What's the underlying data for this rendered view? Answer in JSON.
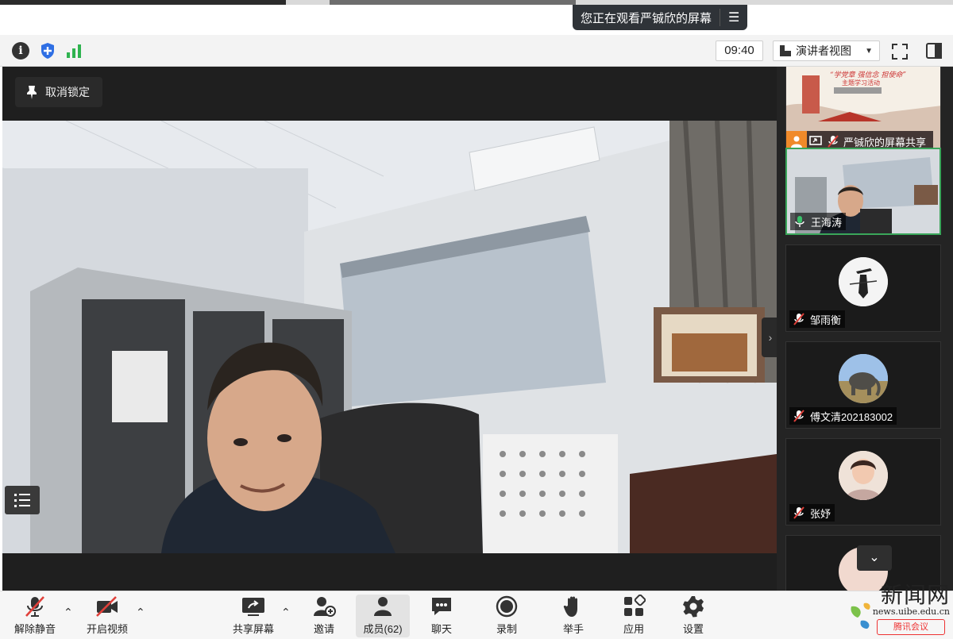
{
  "banner": {
    "sharing_text": "您正在观看严铖欣的屏幕"
  },
  "topbar": {
    "time": "09:40",
    "view_mode": "演讲者视图"
  },
  "stage": {
    "pin_label": "取消锁定"
  },
  "participants": [
    {
      "name": "严铖欣的屏幕共享",
      "type": "screen-share",
      "slide_title": "“学党章 强信念 担使命”",
      "slide_subtitle": "主题学习活动"
    },
    {
      "name": "王海涛",
      "type": "video",
      "mic": "on",
      "active": true
    },
    {
      "name": "邹雨衡",
      "type": "avatar",
      "mic": "muted",
      "avatar_icon": "swordsman-avatar"
    },
    {
      "name": "傅文清202183002",
      "type": "avatar",
      "mic": "muted",
      "avatar_icon": "elephant-avatar"
    },
    {
      "name": "张妤",
      "type": "avatar",
      "mic": "muted",
      "avatar_icon": "person-avatar"
    }
  ],
  "toolbar": {
    "unmute": "解除静音",
    "start_video": "开启视频",
    "share_screen": "共享屏幕",
    "invite": "邀请",
    "members": "成员(62)",
    "chat": "聊天",
    "record": "录制",
    "raise_hand": "举手",
    "apps": "应用",
    "settings": "设置"
  },
  "watermark": {
    "title": "新闻网",
    "url": "news.uibe.edu.cn",
    "badge": "腾讯会议"
  },
  "colors": {
    "active_border": "#3aa65a",
    "muted_red": "#e0403a",
    "mic_green": "#39c06a",
    "stage_bg": "#1f1f1f",
    "panel_bg": "#242424"
  }
}
